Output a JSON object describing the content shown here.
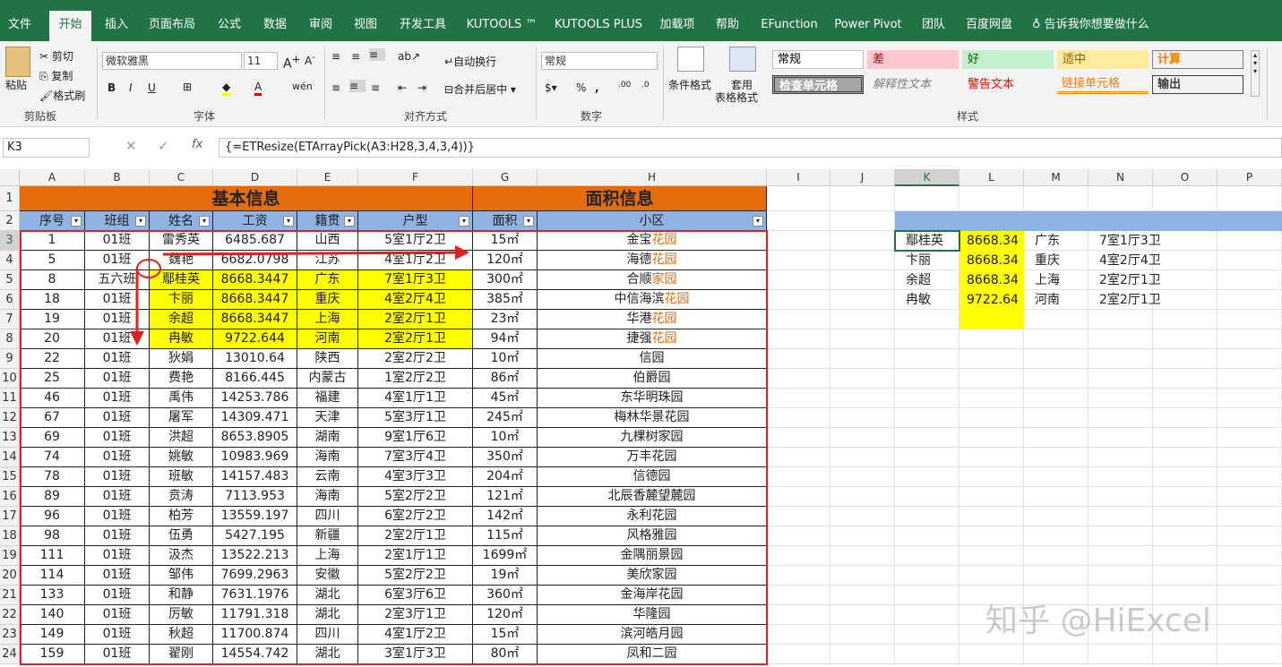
{
  "menu": [
    "文件",
    "开始",
    "插入",
    "页面布局",
    "公式",
    "数据",
    "审阅",
    "视图",
    "开发工具",
    "KUTOOLS ™",
    "KUTOOLS PLUS",
    "加载项",
    "帮助",
    "EFunction",
    "Power Pivot",
    "团队",
    "百度网盘",
    "告诉我你想要做什么"
  ],
  "ribbon": {
    "paste": "粘贴",
    "cut": "剪切",
    "copy": "复制",
    "format_painter": "格式刷",
    "clipboard": "剪贴板",
    "font_name": "微软雅黑",
    "font_size": "11",
    "font": "字体",
    "wrap": "自动换行",
    "merge": "合并后居中",
    "alignment": "对齐方式",
    "number_format": "常规",
    "number": "数字",
    "cond_format": "条件格式",
    "table_format_1": "套用",
    "table_format_2": "表格格式",
    "styles_group": "样式",
    "styles": [
      "常规",
      "差",
      "好",
      "适中",
      "计算",
      "检查单元格",
      "解释性文本",
      "警告文本",
      "链接单元格",
      "输出"
    ]
  },
  "namebox": "K3",
  "formula": "{=ETResize(ETArrayPick(A3:H28,3,4,3,4))}",
  "columns": [
    "A",
    "B",
    "C",
    "D",
    "E",
    "F",
    "G",
    "H",
    "I",
    "J",
    "K",
    "L",
    "M",
    "N",
    "O",
    "P"
  ],
  "rows": [
    "1",
    "2",
    "3",
    "4",
    "5",
    "6",
    "7",
    "8",
    "9",
    "10",
    "11",
    "12",
    "13",
    "14",
    "15",
    "16",
    "17",
    "18",
    "19",
    "20",
    "21",
    "22",
    "23",
    "24"
  ],
  "titles": {
    "basic": "基本信息",
    "area": "面积信息"
  },
  "headers": [
    "序号",
    "班组",
    "姓名",
    "工资",
    "籍贯",
    "户型",
    "面积",
    "小区"
  ],
  "data": [
    [
      "1",
      "01班",
      "雷秀英",
      "6485.687",
      "山西",
      "5室1厅2卫",
      "15㎡",
      "金宝",
      "花园"
    ],
    [
      "5",
      "01班",
      "魏艳",
      "6682.0798",
      "江苏",
      "4室1厅2卫",
      "120㎡",
      "海德",
      "花园"
    ],
    [
      "8",
      "五六班",
      "鄢桂英",
      "8668.3447",
      "广东",
      "7室1厅3卫",
      "300㎡",
      "合顺",
      "家园"
    ],
    [
      "18",
      "01班",
      "卞丽",
      "8668.3447",
      "重庆",
      "4室2厅4卫",
      "385㎡",
      "中信海滨",
      "花园"
    ],
    [
      "19",
      "01班",
      "余超",
      "8668.3447",
      "上海",
      "2室2厅1卫",
      "23㎡",
      "华港",
      "花园"
    ],
    [
      "20",
      "01班",
      "冉敏",
      "9722.644",
      "河南",
      "2室2厅1卫",
      "94㎡",
      "捷强",
      "花园"
    ],
    [
      "22",
      "01班",
      "狄娟",
      "13010.64",
      "陕西",
      "2室2厅2卫",
      "10㎡",
      "信园",
      ""
    ],
    [
      "25",
      "01班",
      "费艳",
      "8166.445",
      "内蒙古",
      "1室2厅2卫",
      "86㎡",
      "伯爵园",
      ""
    ],
    [
      "46",
      "01班",
      "禹伟",
      "14253.786",
      "福建",
      "4室1厅1卫",
      "45㎡",
      "东华明珠园",
      ""
    ],
    [
      "67",
      "01班",
      "屠军",
      "14309.471",
      "天津",
      "5室3厅1卫",
      "245㎡",
      "梅林华景花园",
      ""
    ],
    [
      "69",
      "01班",
      "洪超",
      "8653.8905",
      "湖南",
      "9室1厅6卫",
      "10㎡",
      "九棵树家园",
      ""
    ],
    [
      "74",
      "01班",
      "姚敏",
      "10983.969",
      "海南",
      "7室3厅4卫",
      "350㎡",
      "万丰花园",
      ""
    ],
    [
      "78",
      "01班",
      "班敏",
      "14157.483",
      "云南",
      "4室3厅3卫",
      "204㎡",
      "信德园",
      ""
    ],
    [
      "89",
      "01班",
      "贲涛",
      "7113.953",
      "海南",
      "5室2厅2卫",
      "121㎡",
      "北辰香麓望麓园",
      ""
    ],
    [
      "96",
      "01班",
      "柏芳",
      "13559.197",
      "四川",
      "6室2厅2卫",
      "142㎡",
      "永利花园",
      ""
    ],
    [
      "98",
      "01班",
      "伍勇",
      "5427.195",
      "新疆",
      "2室2厅1卫",
      "115㎡",
      "风格雅园",
      ""
    ],
    [
      "111",
      "01班",
      "汲杰",
      "13522.213",
      "上海",
      "2室1厅1卫",
      "1699㎡",
      "金隅丽景园",
      ""
    ],
    [
      "114",
      "01班",
      "邹伟",
      "7699.2963",
      "安徽",
      "5室2厅2卫",
      "19㎡",
      "美欣家园",
      ""
    ],
    [
      "133",
      "01班",
      "和静",
      "7631.1976",
      "湖北",
      "6室3厅6卫",
      "360㎡",
      "金海岸花园",
      ""
    ],
    [
      "140",
      "01班",
      "厉敏",
      "11791.318",
      "湖北",
      "2室3厅1卫",
      "120㎡",
      "华隆园",
      ""
    ],
    [
      "149",
      "01班",
      "秋超",
      "11700.874",
      "四川",
      "4室1厅2卫",
      "15㎡",
      "滨河皓月园",
      ""
    ],
    [
      "159",
      "01班",
      "翟刚",
      "14554.742",
      "湖北",
      "3室1厅3卫",
      "80㎡",
      "凤和二园",
      ""
    ]
  ],
  "result": [
    [
      "鄢桂英",
      "8668.34",
      "广东",
      "7室1厅3卫"
    ],
    [
      "卞丽",
      "8668.34",
      "重庆",
      "4室2厅4卫"
    ],
    [
      "余超",
      "8668.34",
      "上海",
      "2室2厅1卫"
    ],
    [
      "冉敏",
      "9722.64",
      "河南",
      "2室2厅1卫"
    ]
  ],
  "watermark": "知乎 @HiExcel"
}
